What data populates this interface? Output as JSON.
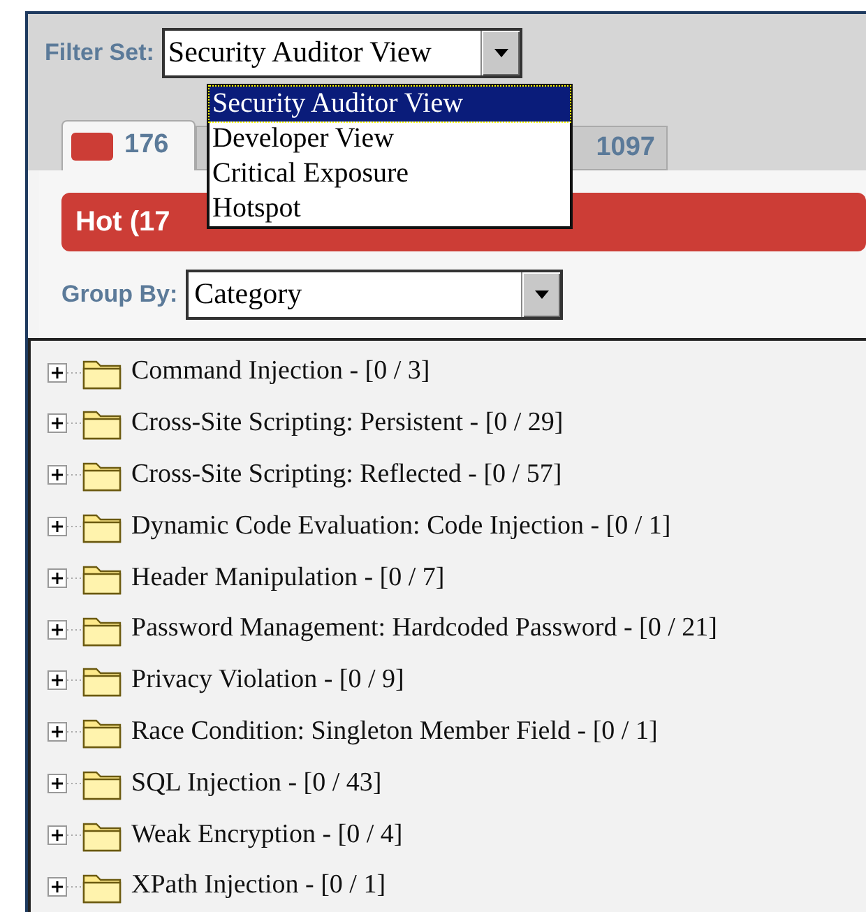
{
  "filter_set": {
    "label": "Filter Set:",
    "value": "Security Auditor View",
    "open": true,
    "options": [
      {
        "label": "Security Auditor View",
        "selected": true
      },
      {
        "label": "Developer View",
        "selected": false
      },
      {
        "label": "Critical Exposure",
        "selected": false
      },
      {
        "label": "Hotspot",
        "selected": false
      }
    ]
  },
  "tabs": [
    {
      "label": "176",
      "color": "#cc3d36",
      "selected": true
    },
    {
      "label": "1097",
      "selected": false
    }
  ],
  "hot_bar": {
    "label": "Hot (17"
  },
  "group_by": {
    "label": "Group By:",
    "value": "Category"
  },
  "tree": [
    {
      "label": "Command Injection - [0 / 3]",
      "expanded": false
    },
    {
      "label": "Cross-Site Scripting: Persistent - [0 / 29]",
      "expanded": false
    },
    {
      "label": "Cross-Site Scripting: Reflected - [0 / 57]",
      "expanded": false
    },
    {
      "label": "Dynamic Code Evaluation: Code Injection - [0 / 1]",
      "expanded": false
    },
    {
      "label": "Header Manipulation - [0 / 7]",
      "expanded": false
    },
    {
      "label": "Password Management: Hardcoded Password - [0 / 21]",
      "expanded": false
    },
    {
      "label": "Privacy Violation - [0 / 9]",
      "expanded": false
    },
    {
      "label": "Race Condition: Singleton Member Field - [0 / 1]",
      "expanded": false
    },
    {
      "label": "SQL Injection - [0 / 43]",
      "expanded": false
    },
    {
      "label": "Weak Encryption - [0 / 4]",
      "expanded": false
    },
    {
      "label": "XPath Injection - [0 / 1]",
      "expanded": false
    }
  ]
}
